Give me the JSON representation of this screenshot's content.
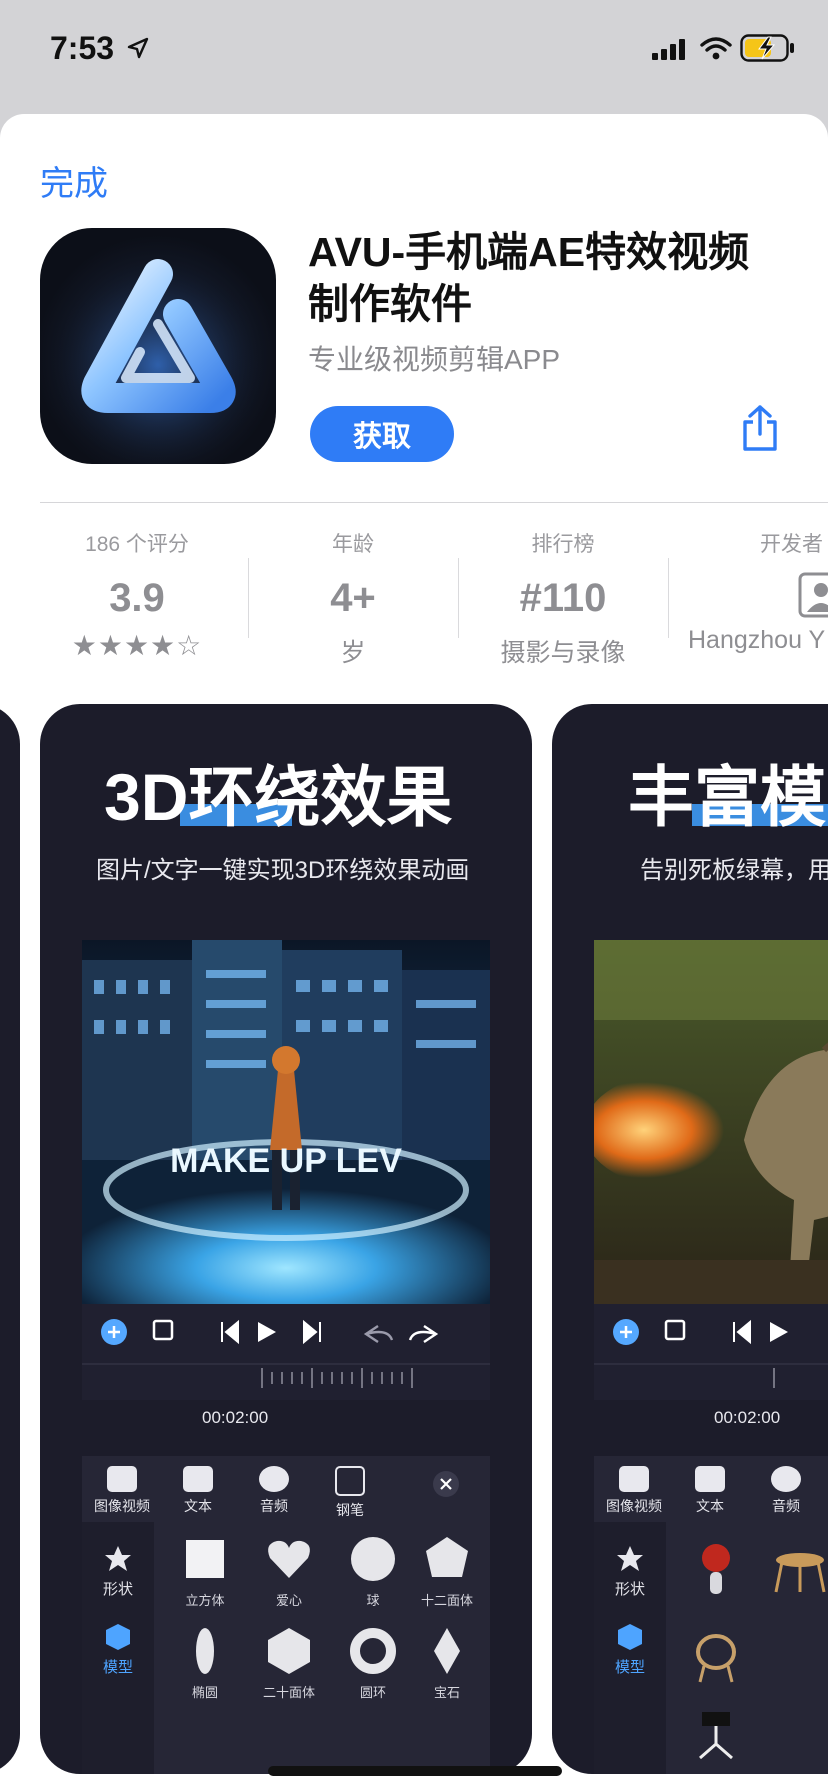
{
  "status": {
    "time": "7:53"
  },
  "sheet": {
    "done_label": "完成"
  },
  "app": {
    "title": "AVU-手机端AE特效视频制作软件",
    "subtitle": "专业级视频剪辑APP",
    "get_label": "获取"
  },
  "info": {
    "ratings": {
      "label": "186 个评分",
      "value": "3.9",
      "stars": "★★★★☆"
    },
    "age": {
      "label": "年龄",
      "value": "4+",
      "sub": "岁"
    },
    "rank": {
      "label": "排行榜",
      "value": "#110",
      "sub": "摄影与录像"
    },
    "developer": {
      "label": "开发者",
      "sub": "Hangzhou Y"
    }
  },
  "screenshots": [
    {
      "heading": "3D环绕效果",
      "caption": "图片/文字一键实现3D环绕效果动画",
      "image_text": "MAKE UP LEV",
      "time": "00:02:00",
      "tools": [
        "图像视频",
        "文本",
        "音频",
        "钢笔"
      ],
      "side": [
        "形状",
        "模型"
      ],
      "shapes": [
        "立方体",
        "爱心",
        "球",
        "十二面体",
        "椭圆",
        "二十面体",
        "圆环",
        "宝石"
      ]
    },
    {
      "heading": "丰富模",
      "caption": "告别死板绿幕，用",
      "time": "00:02:00",
      "tools": [
        "图像视频",
        "文本",
        "音频"
      ],
      "side": [
        "形状",
        "模型"
      ]
    }
  ]
}
